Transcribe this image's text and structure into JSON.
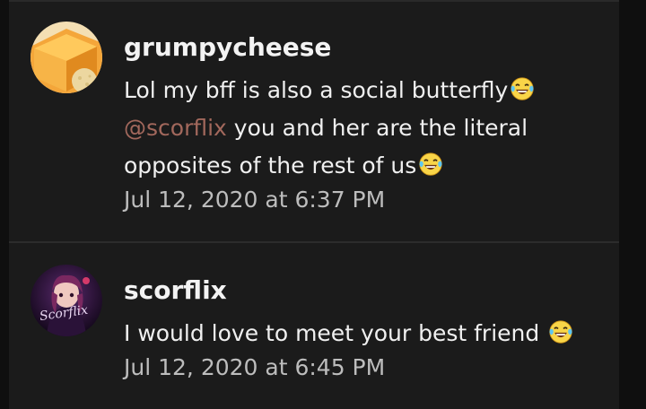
{
  "comments": [
    {
      "username": "grumpycheese",
      "lines": [
        {
          "text": "Lol my bff is also a social butterfly"
        },
        {
          "mention": "@scorflix",
          "text": " you and her are the literal"
        },
        {
          "text": "opposites of the rest of us"
        }
      ],
      "timestamp": "Jul 12, 2020 at 6:37 PM",
      "avatar_icon": "cheese-avatar",
      "emoji_icon": "laughing-tears-emoji"
    },
    {
      "username": "scorflix",
      "lines": [
        {
          "text": "I would love to meet your best friend "
        }
      ],
      "timestamp": "Jul 12, 2020 at 6:45 PM",
      "avatar_icon": "anime-girl-avatar",
      "avatar_signature": "Scorflix",
      "emoji_icon": "laughing-tears-emoji"
    }
  ],
  "colors": {
    "background": "#1b1b1b",
    "text": "#f0f0f0",
    "mention": "#a2685c",
    "timestamp": "#bdbdbd"
  }
}
